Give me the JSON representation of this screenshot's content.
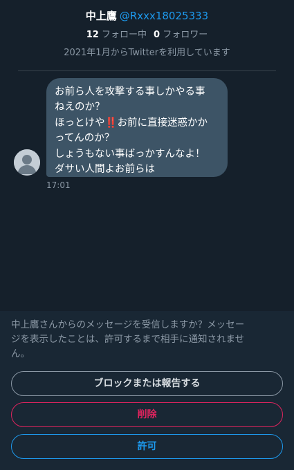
{
  "profile": {
    "display_name": "中上鷹",
    "handle": "@Rxxx18025333",
    "following_count": "12",
    "following_label": "フォロー中",
    "followers_count": "0",
    "followers_label": "フォロワー",
    "joined_text": "2021年1月からTwitterを利用しています"
  },
  "message": {
    "line1": "お前ら人を攻撃する事しかやる事",
    "line2": "ねえのか？",
    "line3_start": "ほっとけや",
    "line3_emoji": "‼️",
    "line3_end": "お前に直接迷惑かか",
    "line4": "ってんのか？",
    "line5": "しょうもない事ばっかすんなよ！",
    "line6": "ダサい人間よお前らは",
    "timestamp": "17:01",
    "avatar_icon": "default-avatar-icon"
  },
  "request_panel": {
    "prompt_line1": "中上鷹さんからのメッセージを受信しますか？メッセー",
    "prompt_line2": "ジを表示したことは、許可するまで相手に通知されませ",
    "prompt_line3": "ん。",
    "block_label": "ブロックまたは報告する",
    "delete_label": "削除",
    "accept_label": "許可"
  },
  "colors": {
    "background": "#15202b",
    "panel_background": "#192734",
    "bubble": "#3d5466",
    "accent_blue": "#1d9bf0",
    "danger_red": "#e0245e",
    "muted_text": "#8b98a5"
  }
}
